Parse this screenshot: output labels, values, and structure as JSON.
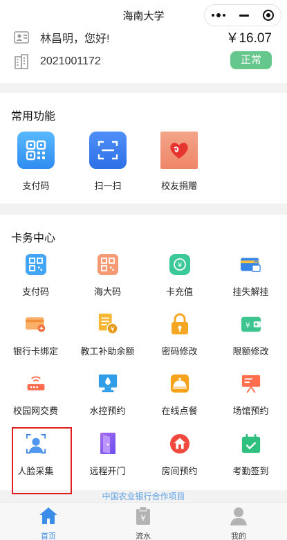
{
  "header": {
    "title": "海南大学"
  },
  "user": {
    "greeting": "林昌明，您好!",
    "card_no": "2021001172",
    "balance": "￥16.07",
    "status": "正常"
  },
  "quick": {
    "title": "常用功能",
    "items": [
      {
        "label": "支付码",
        "icon": "qr-code-icon"
      },
      {
        "label": "扫一扫",
        "icon": "scan-icon"
      },
      {
        "label": "校友捐赠",
        "icon": "heart-donation-icon"
      }
    ]
  },
  "card_center": {
    "title": "卡务中心",
    "items": [
      {
        "label": "支付码",
        "icon": "qr-code-icon"
      },
      {
        "label": "海大码",
        "icon": "hd-code-icon"
      },
      {
        "label": "卡充值",
        "icon": "card-recharge-icon"
      },
      {
        "label": "挂失解挂",
        "icon": "card-lock-icon"
      },
      {
        "label": "银行卡绑定",
        "icon": "bank-card-link-icon"
      },
      {
        "label": "教工补助余额",
        "icon": "subsidy-icon"
      },
      {
        "label": "密码修改",
        "icon": "padlock-icon"
      },
      {
        "label": "限额修改",
        "icon": "wallet-icon"
      },
      {
        "label": "校园网交费",
        "icon": "router-icon"
      },
      {
        "label": "水控预约",
        "icon": "water-drop-icon"
      },
      {
        "label": "在线点餐",
        "icon": "dining-cloche-icon"
      },
      {
        "label": "场馆预约",
        "icon": "presentation-board-icon"
      },
      {
        "label": "人脸采集",
        "icon": "face-scan-icon"
      },
      {
        "label": "远程开门",
        "icon": "door-icon"
      },
      {
        "label": "房间预约",
        "icon": "house-icon"
      },
      {
        "label": "考勤签到",
        "icon": "calendar-check-icon"
      }
    ]
  },
  "footer": {
    "partner": "中国农业银行合作项目"
  },
  "tabs": [
    {
      "label": "首页",
      "icon": "home-icon",
      "active": true
    },
    {
      "label": "流水",
      "icon": "transactions-icon",
      "active": false
    },
    {
      "label": "我的",
      "icon": "profile-icon",
      "active": false
    }
  ],
  "colors": {
    "active_tab": "#3b8de8",
    "status_badge": "#65c78b",
    "link": "#5aa0e6",
    "highlight": "#e02020"
  }
}
